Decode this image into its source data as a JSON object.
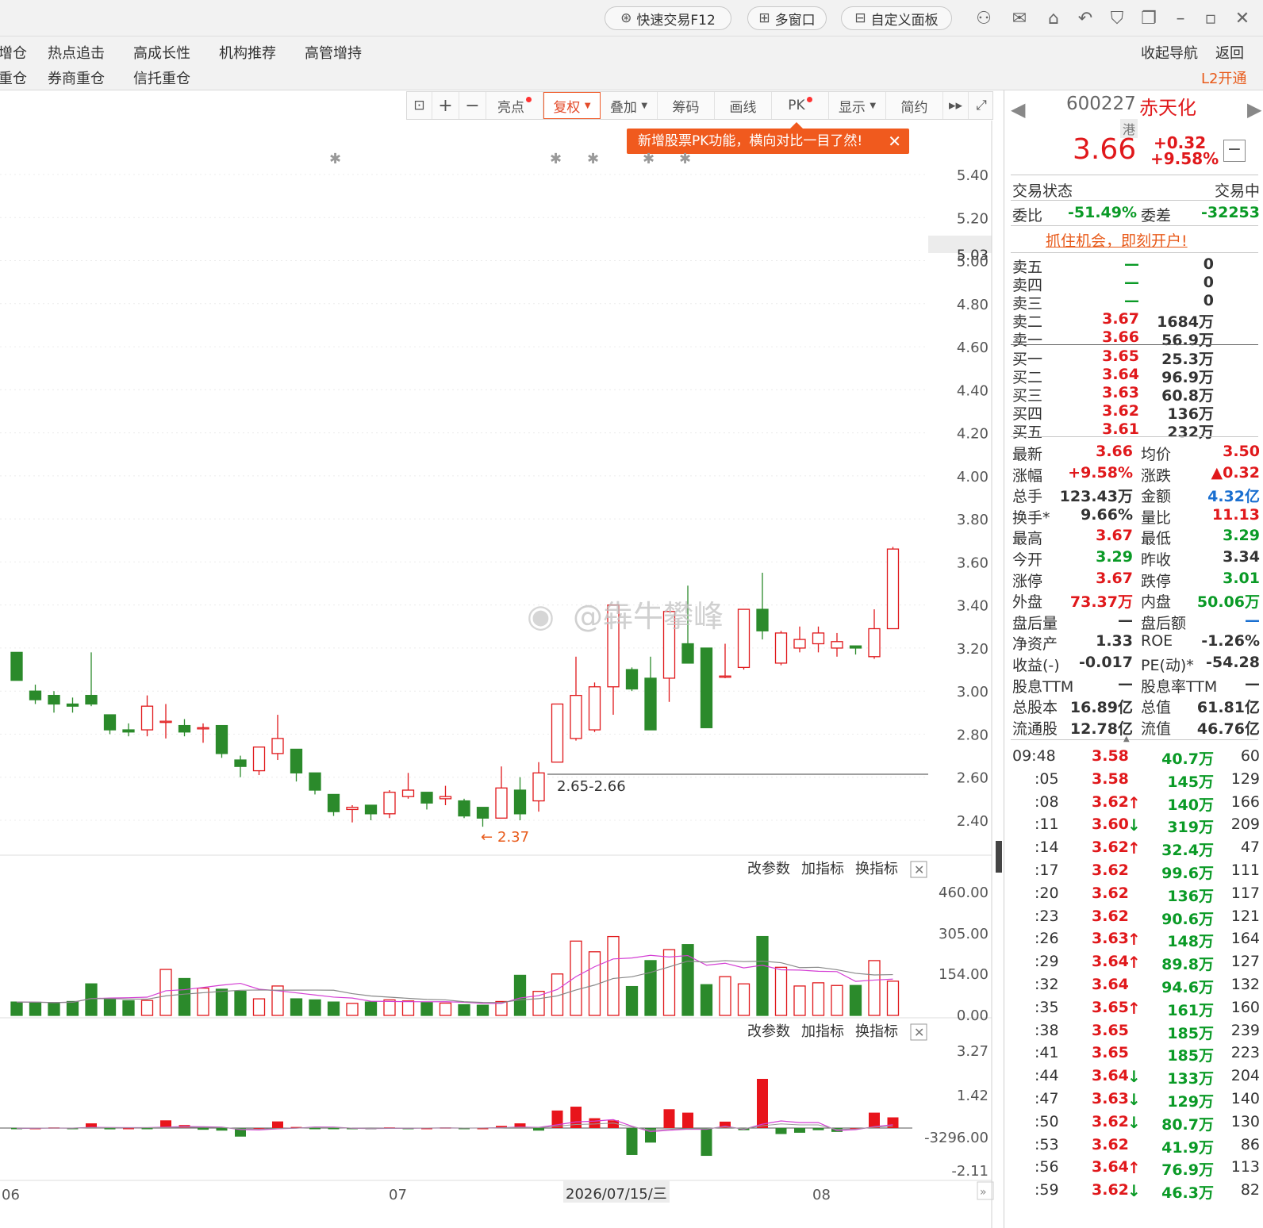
{
  "titlebar": {
    "quick_trade": "快速交易F12",
    "multi_window": "多窗口",
    "custom_panel": "自定义面板"
  },
  "nav": {
    "row1": [
      "增仓",
      "热点追击",
      "高成长性",
      "机构推荐",
      "高管增持"
    ],
    "row2": [
      "重仓",
      "券商重仓",
      "信托重仓"
    ],
    "collapse": "收起导航",
    "back": "返回",
    "l2": "L2开通"
  },
  "toolbar": {
    "items": [
      "亮点",
      "复权",
      "叠加",
      "筹码",
      "画线",
      "PK",
      "显示",
      "简约"
    ],
    "active": "复权"
  },
  "tip": "新增股票PK功能，横向对比一目了然!",
  "stock": {
    "code": "600227",
    "name": "赤天化",
    "tag": "港",
    "price": "3.66",
    "change": "+0.32",
    "pct": "+9.58%"
  },
  "status": {
    "label": "交易状态",
    "value": "交易中",
    "wb_label": "委比",
    "wb": "-51.49%",
    "wc_label": "委差",
    "wc": "-32253"
  },
  "open_account": "抓住机会，即刻开户!",
  "asks": [
    {
      "l": "卖五",
      "p": "—",
      "v": "0"
    },
    {
      "l": "卖四",
      "p": "—",
      "v": "0"
    },
    {
      "l": "卖三",
      "p": "—",
      "v": "0"
    },
    {
      "l": "卖二",
      "p": "3.67",
      "v": "1684万"
    },
    {
      "l": "卖一",
      "p": "3.66",
      "v": "56.9万"
    }
  ],
  "bids": [
    {
      "l": "买一",
      "p": "3.65",
      "v": "25.3万"
    },
    {
      "l": "买二",
      "p": "3.64",
      "v": "96.9万"
    },
    {
      "l": "买三",
      "p": "3.63",
      "v": "60.8万"
    },
    {
      "l": "买四",
      "p": "3.62",
      "v": "136万"
    },
    {
      "l": "买五",
      "p": "3.61",
      "v": "232万"
    }
  ],
  "stats": [
    [
      "最新",
      "3.66",
      "均价",
      "3.50"
    ],
    [
      "涨幅",
      "+9.58%",
      "涨跌",
      "▲0.32"
    ],
    [
      "总手",
      "123.43万",
      "金额",
      "4.32亿"
    ],
    [
      "换手*",
      "9.66%",
      "量比",
      "11.13"
    ],
    [
      "最高",
      "3.67",
      "最低",
      "3.29"
    ],
    [
      "今开",
      "3.29",
      "昨收",
      "3.34"
    ],
    [
      "涨停",
      "3.67",
      "跌停",
      "3.01"
    ],
    [
      "外盘",
      "73.37万",
      "内盘",
      "50.06万"
    ],
    [
      "盘后量",
      "—",
      "盘后额",
      "—"
    ],
    [
      "净资产",
      "1.33",
      "ROE",
      "-1.26%"
    ],
    [
      "收益(-)",
      "-0.017",
      "PE(动)*",
      "-54.28"
    ],
    [
      "股息TTM",
      "—",
      "股息率TTM",
      "—"
    ],
    [
      "总股本",
      "16.89亿",
      "总值",
      "61.81亿"
    ],
    [
      "流通股",
      "12.78亿",
      "流值",
      "46.76亿"
    ]
  ],
  "ticks": [
    [
      "09:48",
      "3.58",
      "",
      "40.7万",
      "60"
    ],
    [
      ":05",
      "3.58",
      "",
      "145万",
      "129"
    ],
    [
      ":08",
      "3.62",
      "up",
      "140万",
      "166"
    ],
    [
      ":11",
      "3.60",
      "down",
      "319万",
      "209"
    ],
    [
      ":14",
      "3.62",
      "up",
      "32.4万",
      "47"
    ],
    [
      ":17",
      "3.62",
      "",
      "99.6万",
      "111"
    ],
    [
      ":20",
      "3.62",
      "",
      "136万",
      "117"
    ],
    [
      ":23",
      "3.62",
      "",
      "90.6万",
      "121"
    ],
    [
      ":26",
      "3.63",
      "up",
      "148万",
      "164"
    ],
    [
      ":29",
      "3.64",
      "up",
      "89.8万",
      "127"
    ],
    [
      ":32",
      "3.64",
      "",
      "94.6万",
      "132"
    ],
    [
      ":35",
      "3.65",
      "up",
      "161万",
      "160"
    ],
    [
      ":38",
      "3.65",
      "",
      "185万",
      "239"
    ],
    [
      ":41",
      "3.65",
      "",
      "185万",
      "223"
    ],
    [
      ":44",
      "3.64",
      "down",
      "133万",
      "204"
    ],
    [
      ":47",
      "3.63",
      "down",
      "129万",
      "140"
    ],
    [
      ":50",
      "3.62",
      "down",
      "80.7万",
      "130"
    ],
    [
      ":53",
      "3.62",
      "",
      "41.9万",
      "86"
    ],
    [
      ":56",
      "3.64",
      "up",
      "76.9万",
      "113"
    ],
    [
      ":59",
      "3.62",
      "down",
      "46.3万",
      "82"
    ]
  ],
  "indicator": {
    "params": "改参数",
    "add": "加指标",
    "switch": "换指标"
  },
  "watermark": "@犇牛攀峰",
  "chart_data": {
    "type": "candlestick",
    "price_axis": {
      "ticks": [
        "5.40",
        "5.20",
        "5.03",
        "5.00",
        "4.80",
        "4.60",
        "4.40",
        "4.20",
        "4.00",
        "3.80",
        "3.60",
        "3.40",
        "3.20",
        "3.00",
        "2.80",
        "2.60",
        "2.40"
      ],
      "ylim": [
        2.3,
        5.5
      ]
    },
    "volume_axis": {
      "ticks": [
        "460.00",
        "305.00",
        "154.00",
        "0.00"
      ]
    },
    "macd_axis": {
      "ticks": [
        "3.27",
        "1.42",
        "-3296.00",
        "-2.11"
      ]
    },
    "x_labels": [
      "06",
      "07",
      "2026/07/15/三",
      "08"
    ],
    "annotations": {
      "low": "2.37",
      "gap": "2.65-2.66"
    },
    "candles": [
      [
        3.18,
        3.05,
        3.18,
        3.05
      ],
      [
        3.0,
        2.96,
        3.03,
        2.94
      ],
      [
        2.98,
        2.94,
        3.0,
        2.9
      ],
      [
        2.94,
        2.93,
        2.97,
        2.9
      ],
      [
        2.98,
        2.94,
        3.18,
        2.93
      ],
      [
        2.89,
        2.82,
        2.89,
        2.8
      ],
      [
        2.82,
        2.81,
        2.85,
        2.79
      ],
      [
        2.82,
        2.93,
        2.98,
        2.79
      ],
      [
        2.86,
        2.86,
        2.94,
        2.78
      ],
      [
        2.84,
        2.81,
        2.87,
        2.79
      ],
      [
        2.83,
        2.83,
        2.85,
        2.76
      ],
      [
        2.84,
        2.71,
        2.84,
        2.69
      ],
      [
        2.68,
        2.65,
        2.7,
        2.6
      ],
      [
        2.63,
        2.74,
        2.74,
        2.61
      ],
      [
        2.71,
        2.78,
        2.89,
        2.68
      ],
      [
        2.73,
        2.62,
        2.73,
        2.58
      ],
      [
        2.62,
        2.54,
        2.62,
        2.52
      ],
      [
        2.52,
        2.44,
        2.52,
        2.42
      ],
      [
        2.45,
        2.46,
        2.47,
        2.39
      ],
      [
        2.47,
        2.43,
        2.47,
        2.4
      ],
      [
        2.43,
        2.53,
        2.54,
        2.41
      ],
      [
        2.51,
        2.54,
        2.62,
        2.5
      ],
      [
        2.53,
        2.48,
        2.53,
        2.45
      ],
      [
        2.5,
        2.51,
        2.56,
        2.47
      ],
      [
        2.49,
        2.42,
        2.5,
        2.41
      ],
      [
        2.46,
        2.41,
        2.46,
        2.37
      ],
      [
        2.41,
        2.55,
        2.65,
        2.41
      ],
      [
        2.54,
        2.43,
        2.6,
        2.4
      ],
      [
        2.49,
        2.62,
        2.67,
        2.44
      ],
      [
        2.67,
        2.94,
        2.94,
        2.67
      ],
      [
        2.78,
        2.98,
        3.16,
        2.77
      ],
      [
        2.82,
        3.02,
        3.04,
        2.81
      ],
      [
        3.02,
        3.4,
        3.4,
        2.89
      ],
      [
        3.1,
        3.01,
        3.11,
        3.0
      ],
      [
        3.06,
        2.82,
        3.16,
        2.82
      ],
      [
        3.06,
        3.37,
        3.37,
        2.95
      ],
      [
        3.22,
        3.13,
        3.49,
        3.13
      ],
      [
        3.2,
        2.83,
        3.19,
        2.83
      ],
      [
        3.07,
        3.07,
        3.22,
        3.06
      ],
      [
        3.11,
        3.38,
        3.38,
        3.1
      ],
      [
        3.38,
        3.28,
        3.55,
        3.24
      ],
      [
        3.13,
        3.27,
        3.28,
        3.12
      ],
      [
        3.2,
        3.24,
        3.3,
        3.18
      ],
      [
        3.22,
        3.27,
        3.3,
        3.18
      ],
      [
        3.2,
        3.23,
        3.27,
        3.16
      ],
      [
        3.21,
        3.2,
        3.21,
        3.17
      ],
      [
        3.16,
        3.29,
        3.38,
        3.15
      ],
      [
        3.29,
        3.66,
        3.67,
        3.29
      ]
    ],
    "volumes": [
      50,
      49,
      46,
      52,
      118,
      60,
      55,
      56,
      172,
      138,
      102,
      98,
      90,
      62,
      110,
      62,
      58,
      50,
      45,
      50,
      58,
      54,
      48,
      46,
      40,
      38,
      52,
      150,
      90,
      155,
      278,
      238,
      295,
      108,
      205,
      246,
      265,
      115,
      145,
      118,
      295,
      180,
      110,
      122,
      112,
      112,
      205,
      128
    ],
    "macd": [
      -0.03,
      0.0,
      0.03,
      -0.04,
      0.22,
      -0.06,
      0.0,
      -0.02,
      0.36,
      0.14,
      -0.08,
      -0.12,
      -0.4,
      0.0,
      0.31,
      0.05,
      -0.03,
      -0.05,
      -0.04,
      -0.03,
      0.03,
      -0.02,
      0.0,
      0.03,
      -0.02,
      0.0,
      0.1,
      0.22,
      -0.12,
      0.82,
      1.0,
      0.46,
      0.36,
      -1.26,
      -0.68,
      0.88,
      0.72,
      -1.3,
      0.3,
      -0.1,
      2.3,
      -0.28,
      -0.22,
      -0.1,
      -0.18,
      0.0,
      0.72,
      0.5
    ]
  }
}
